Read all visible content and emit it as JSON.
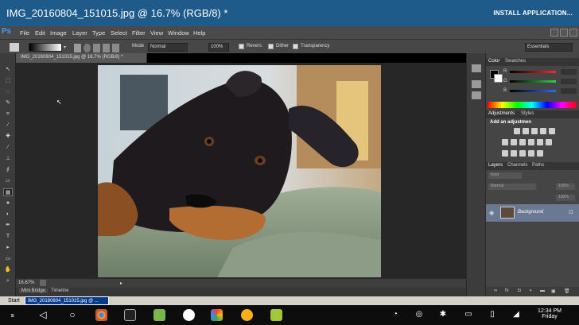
{
  "window": {
    "title": "IMG_20160804_151015.jpg @ 16.7% (RGB/8) *",
    "install_label": "INSTALL APPLICATION..."
  },
  "menu": {
    "logo": "Ps",
    "items": [
      "File",
      "Edit",
      "Image",
      "Layer",
      "Type",
      "Select",
      "Filter",
      "View",
      "Window",
      "Help"
    ]
  },
  "options": {
    "mode_label": "Mode",
    "mode_value": "Normal",
    "opacity_value": "100%",
    "reverse_label": "Revers",
    "dither_label": "Dither",
    "transparency_label": "Transparency",
    "workspace_value": "Essentials"
  },
  "document": {
    "tab_label": "IMG_20160804_151015.jpg @ 16.7% (RGB/8) *",
    "zoom": "16.67%"
  },
  "bottom_tabs": [
    "Mini Bridge",
    "Timeline"
  ],
  "panels": {
    "color_tabs": [
      "Color",
      "Swatches"
    ],
    "adjustments_tabs": [
      "Adjustments",
      "Styles"
    ],
    "adjustments_hint": "Add an adjustmen",
    "layers_tabs": [
      "Layers",
      "Channels",
      "Paths"
    ],
    "kind_label": "Kind",
    "blend_value": "Normal",
    "opacity_value": "100%",
    "fill_value": "100%",
    "layer_name": "Background"
  },
  "taskbar": {
    "start_label": "Start",
    "task_label": "IMG_20160804_151015.jpg @ ..."
  },
  "clock": {
    "time": "12:34 PM",
    "day": "Friday"
  },
  "colors": {
    "titlebar": "#1f5b8a",
    "slider_red": "#ff2a2a",
    "slider_green": "#2bd14a",
    "slider_blue": "#2a6bff"
  }
}
